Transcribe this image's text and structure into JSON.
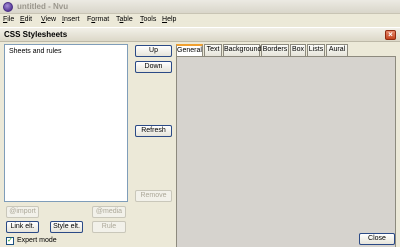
{
  "app": {
    "title": "untitled - Nvu"
  },
  "menu": [
    "File",
    "Edit",
    "View",
    "Insert",
    "Format",
    "Table",
    "Tools",
    "Help"
  ],
  "menu_mnemonics": [
    "F",
    "E",
    "V",
    "I",
    "o",
    "a",
    "T",
    "H"
  ],
  "dialog": {
    "title": "CSS Stylesheets",
    "close_label": "×",
    "list": {
      "items": [
        "Sheets and rules"
      ]
    },
    "buttons": {
      "up": "Up",
      "down": "Down",
      "refresh": "Refresh",
      "remove": "Remove",
      "import": "@import",
      "media": "@media",
      "link": "Link elt.",
      "style": "Style elt.",
      "rule": "Rule",
      "close": "Close"
    },
    "tabs": [
      "General",
      "Text",
      "Background",
      "Borders",
      "Box",
      "Lists",
      "Aural"
    ],
    "active_tab": "General",
    "expert_mode": {
      "label": "Expert mode",
      "checked": true,
      "mark": "✓"
    }
  }
}
